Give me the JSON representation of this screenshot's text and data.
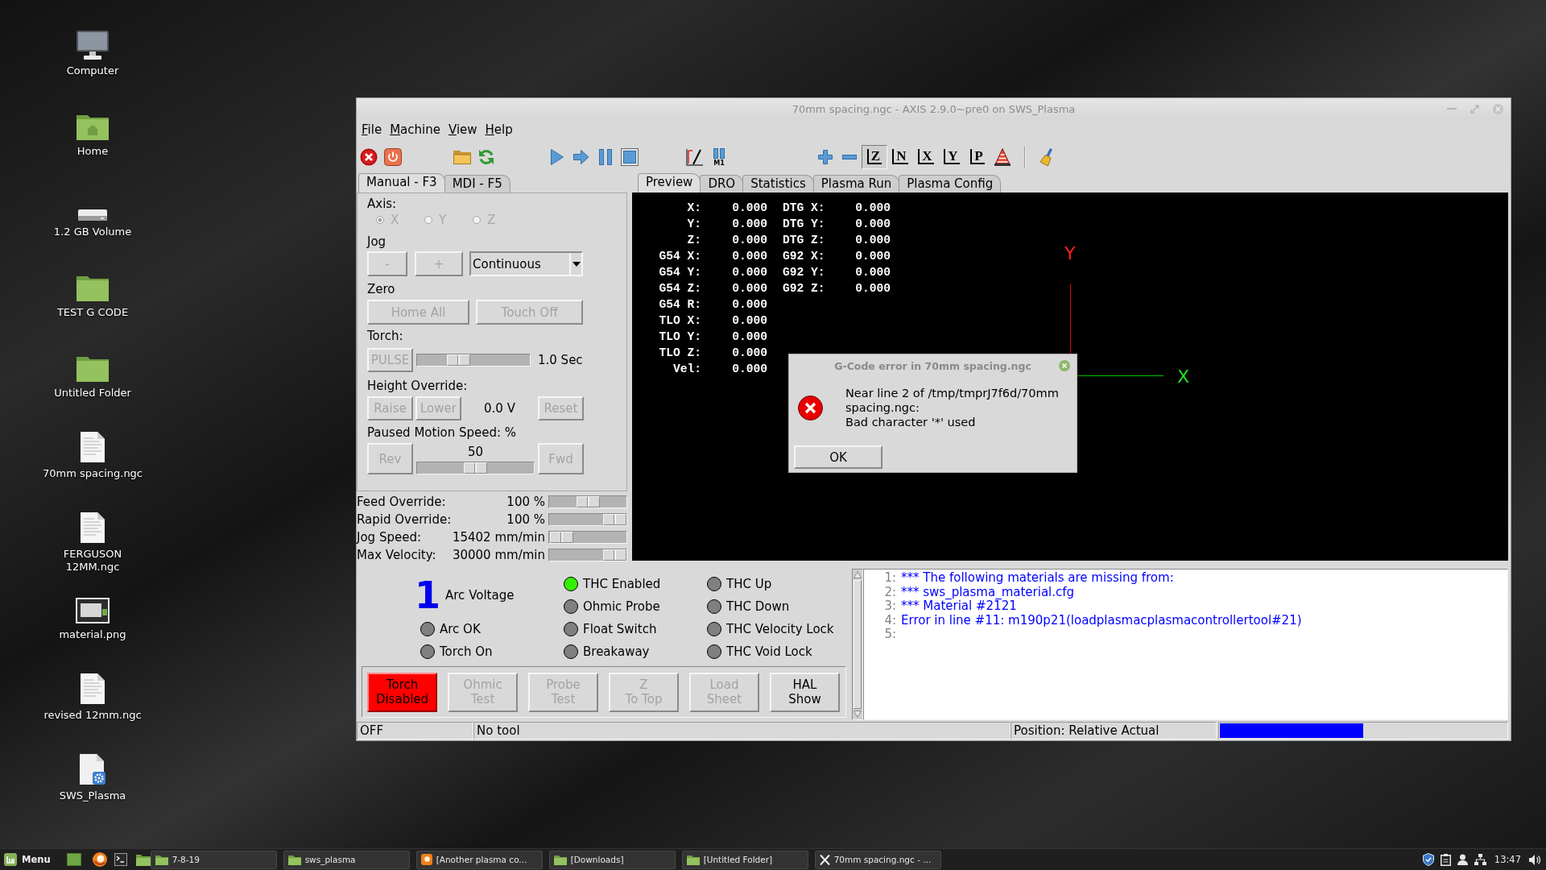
{
  "desktop": {
    "icons": [
      {
        "label": "Computer",
        "kind": "computer"
      },
      {
        "label": "Home",
        "kind": "home"
      },
      {
        "label": "1.2 GB Volume",
        "kind": "drive"
      },
      {
        "label": "TEST G CODE",
        "kind": "folder"
      },
      {
        "label": "Untitled Folder",
        "kind": "folder"
      },
      {
        "label": "70mm spacing.ngc",
        "kind": "document"
      },
      {
        "label": "FERGUSON 12MM.ngc",
        "kind": "document"
      },
      {
        "label": "material.png",
        "kind": "image"
      },
      {
        "label": "revised 12mm.ngc",
        "kind": "document"
      },
      {
        "label": "SWS_Plasma",
        "kind": "launcher"
      }
    ]
  },
  "window": {
    "title": "70mm spacing.ngc - AXIS 2.9.0~pre0 on SWS_Plasma",
    "menu": [
      "File",
      "Machine",
      "View",
      "Help"
    ],
    "toolbar": [
      {
        "kind": "estop"
      },
      {
        "kind": "power"
      },
      {
        "kind": "open"
      },
      {
        "kind": "reload"
      },
      {
        "kind": "run"
      },
      {
        "kind": "step"
      },
      {
        "kind": "pause"
      },
      {
        "kind": "stop"
      },
      {
        "kind": "block_delete"
      },
      {
        "kind": "optional_stop",
        "label": "M1"
      },
      {
        "kind": "zoom_in"
      },
      {
        "kind": "zoom_out"
      },
      {
        "kind": "view",
        "label": "Z",
        "selected": true
      },
      {
        "kind": "view",
        "label": "N",
        "selected": false
      },
      {
        "kind": "view",
        "label": "X",
        "selected": false
      },
      {
        "kind": "view",
        "label": "Y",
        "selected": false
      },
      {
        "kind": "view",
        "label": "P",
        "selected": false
      },
      {
        "kind": "cone"
      },
      {
        "kind": "clear"
      }
    ]
  },
  "manual_tabs": [
    {
      "label": "Manual - F3",
      "selected": true
    },
    {
      "label": "MDI - F5",
      "selected": false
    }
  ],
  "manual": {
    "axis": {
      "label": "Axis:",
      "disabled": true,
      "options": [
        {
          "label": "X",
          "selected": true
        },
        {
          "label": "Y",
          "selected": false
        },
        {
          "label": "Z",
          "selected": false
        }
      ]
    },
    "jog": {
      "label": "Jog",
      "buttons": [
        {
          "label": "-",
          "disabled": true
        },
        {
          "label": "+",
          "disabled": true
        }
      ],
      "mode": "Continuous"
    },
    "zero": {
      "label": "Zero",
      "buttons": [
        {
          "label": "Home All",
          "disabled": true
        },
        {
          "label": "Touch Off",
          "disabled": true
        }
      ]
    },
    "torch": {
      "label": "Torch:",
      "button": {
        "label": "PULSE",
        "disabled": true
      },
      "level": 0.33,
      "reading": "1.0 Sec"
    },
    "height_override": {
      "label": "Height Override:",
      "buttons": [
        {
          "label": "Raise",
          "disabled": true
        },
        {
          "label": "Lower",
          "disabled": true
        }
      ],
      "reading": "0.0 V",
      "reset": {
        "label": "Reset",
        "disabled": true
      }
    },
    "paused_motion": {
      "label": "Paused Motion Speed: %",
      "rev": {
        "label": "Rev",
        "disabled": true
      },
      "value": "50",
      "level": 0.5,
      "fwd": {
        "label": "Fwd",
        "disabled": true
      }
    }
  },
  "overrides": [
    {
      "label": "Feed Override:",
      "value": "100 %",
      "level": 0.5
    },
    {
      "label": "Rapid Override:",
      "value": "100 %",
      "level": 1
    },
    {
      "label": "Jog Speed:",
      "value": "15402 mm/min",
      "level": 0.02
    },
    {
      "label": "Max Velocity:",
      "value": "30000 mm/min",
      "level": 1
    }
  ],
  "preview_tabs": [
    {
      "label": "Preview",
      "selected": true
    },
    {
      "label": "DRO",
      "selected": false
    },
    {
      "label": "Statistics",
      "selected": false
    },
    {
      "label": "Plasma Run",
      "selected": false
    },
    {
      "label": "Plasma Config",
      "selected": false
    }
  ],
  "preview": {
    "dro_left": [
      {
        "label": "X:",
        "value": "0.000"
      },
      {
        "label": "Y:",
        "value": "0.000"
      },
      {
        "label": "Z:",
        "value": "0.000"
      },
      {
        "label": "G54 X:",
        "value": "0.000"
      },
      {
        "label": "G54 Y:",
        "value": "0.000"
      },
      {
        "label": "G54 Z:",
        "value": "0.000"
      },
      {
        "label": "G54 R:",
        "value": "0.000"
      },
      {
        "label": "TLO X:",
        "value": "0.000"
      },
      {
        "label": "TLO Y:",
        "value": "0.000"
      },
      {
        "label": "TLO Z:",
        "value": "0.000"
      },
      {
        "label": "Vel:",
        "value": "0.000"
      }
    ],
    "dro_right": [
      {
        "label": "DTG X:",
        "value": "0.000"
      },
      {
        "label": "DTG Y:",
        "value": "0.000"
      },
      {
        "label": "DTG Z:",
        "value": "0.000"
      },
      {
        "label": "G92 X:",
        "value": "0.000"
      },
      {
        "label": "G92 Y:",
        "value": "0.000"
      },
      {
        "label": "G92 Z:",
        "value": "0.000"
      }
    ],
    "y_axis_label": "Y",
    "x_axis_label": "X"
  },
  "plasma": {
    "arc_voltage": {
      "value": "1",
      "label": "Arc Voltage"
    },
    "indicator_columns": [
      {
        "leds": [
          {
            "label": "Arc OK",
            "on": false
          },
          {
            "label": "Torch On",
            "on": false
          }
        ]
      },
      {
        "leds": [
          {
            "label": "THC Enabled",
            "on": true
          },
          {
            "label": "Ohmic Probe",
            "on": false
          },
          {
            "label": "Float Switch",
            "on": false
          },
          {
            "label": "Breakaway",
            "on": false
          }
        ]
      },
      {
        "leds": [
          {
            "label": "THC Up",
            "on": false
          },
          {
            "label": "THC Down",
            "on": false
          },
          {
            "label": "THC Velocity Lock",
            "on": false
          },
          {
            "label": "THC Void Lock",
            "on": false
          }
        ]
      }
    ],
    "buttons": [
      {
        "lines": [
          "Torch",
          "Disabled"
        ],
        "disabled": false,
        "alert": true
      },
      {
        "lines": [
          "Ohmic",
          "Test"
        ],
        "disabled": true,
        "alert": false
      },
      {
        "lines": [
          "Probe",
          "Test"
        ],
        "disabled": true,
        "alert": false
      },
      {
        "lines": [
          "Z",
          "To Top"
        ],
        "disabled": true,
        "alert": false
      },
      {
        "lines": [
          "Load",
          "Sheet"
        ],
        "disabled": true,
        "alert": false
      },
      {
        "lines": [
          "HAL",
          "Show"
        ],
        "disabled": false,
        "alert": false
      }
    ]
  },
  "console": {
    "lines": [
      {
        "number": "1:",
        "text": "*** The following materials are missing from:"
      },
      {
        "number": "2:",
        "text": "*** sws_plasma_material.cfg"
      },
      {
        "number": "3:",
        "text": "*** Material #2121"
      },
      {
        "number": "4:",
        "text": "Error in line #11: m190p21(loadplasmacplasmacontrollertool#21)"
      },
      {
        "number": "5:"
      }
    ]
  },
  "status_bar": {
    "state": "OFF",
    "tool": "No tool",
    "position": "Position: Relative Actual",
    "level": 0.5
  },
  "dialog": {
    "title": "G-Code error in 70mm spacing.ngc",
    "message": [
      "Near line 2 of /tmp/tmprJ7f6d/70mm",
      "spacing.ngc:",
      "Bad character '*' used"
    ],
    "button": "OK"
  },
  "taskbar": {
    "menu": "Menu",
    "windows": [
      {
        "label": "7-8-19",
        "kind": "folder"
      },
      {
        "label": "sws_plasma",
        "kind": "folder"
      },
      {
        "label": "[Another plasma co...",
        "kind": "browser"
      },
      {
        "label": "[Downloads]",
        "kind": "folder"
      },
      {
        "label": "[Untitled Folder]",
        "kind": "folder"
      },
      {
        "label": "70mm spacing.ngc - ...",
        "kind": "x"
      }
    ],
    "clock": "13:47"
  }
}
